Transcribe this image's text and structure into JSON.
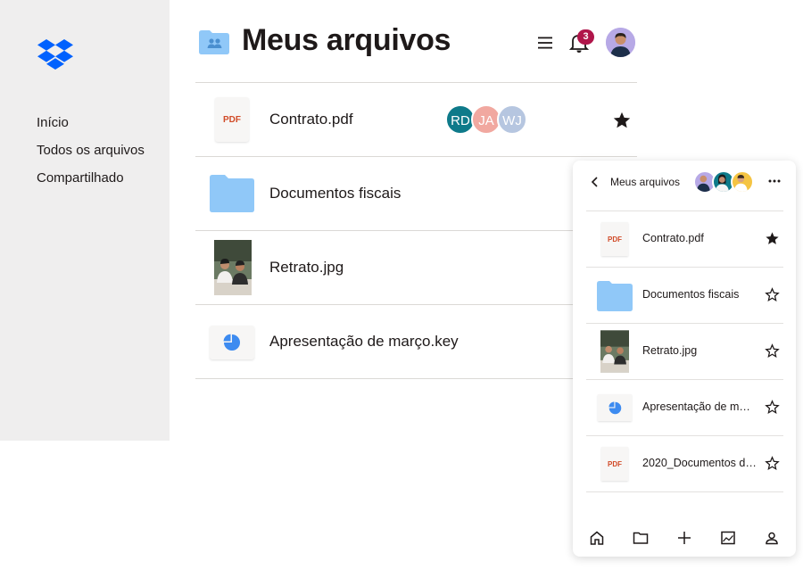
{
  "sidebar": {
    "logo_icon": "dropbox-logo",
    "items": [
      {
        "label": "Início"
      },
      {
        "label": "Todos os arquivos"
      },
      {
        "label": "Compartilhado"
      }
    ]
  },
  "header": {
    "title": "Meus arquivos",
    "folder_icon": "shared-folder-icon",
    "notifications_count": "3"
  },
  "files": [
    {
      "name": "Contrato.pdf",
      "type_label": "PDF",
      "starred": true,
      "collaborators": [
        {
          "initials": "RD",
          "color": "#0e7a8a"
        },
        {
          "initials": "JA",
          "color": "#f1a8a0"
        },
        {
          "initials": "WJ",
          "color": "#b6c6e0"
        }
      ]
    },
    {
      "name": "Documentos fiscais"
    },
    {
      "name": "Retrato.jpg"
    },
    {
      "name": "Apresentação de março.key"
    }
  ],
  "mobile": {
    "title": "Meus arquivos",
    "files": [
      {
        "name": "Contrato.pdf",
        "type_label": "PDF",
        "starred": true
      },
      {
        "name": "Documentos fiscais",
        "starred": false
      },
      {
        "name": "Retrato.jpg",
        "starred": false
      },
      {
        "name": "Apresentação de m…",
        "starred": false
      },
      {
        "name": "2020_Documentos d…",
        "type_label": "PDF",
        "starred": false
      }
    ],
    "tabs": [
      "home-icon",
      "folder-icon",
      "plus-icon",
      "photos-icon",
      "account-icon"
    ]
  },
  "colors": {
    "brand_blue": "#0061fe",
    "folder_blue": "#90c8f8",
    "sidebar_bg": "#efeeee",
    "badge": "#b0154a",
    "pdf_red": "#d14b28"
  }
}
